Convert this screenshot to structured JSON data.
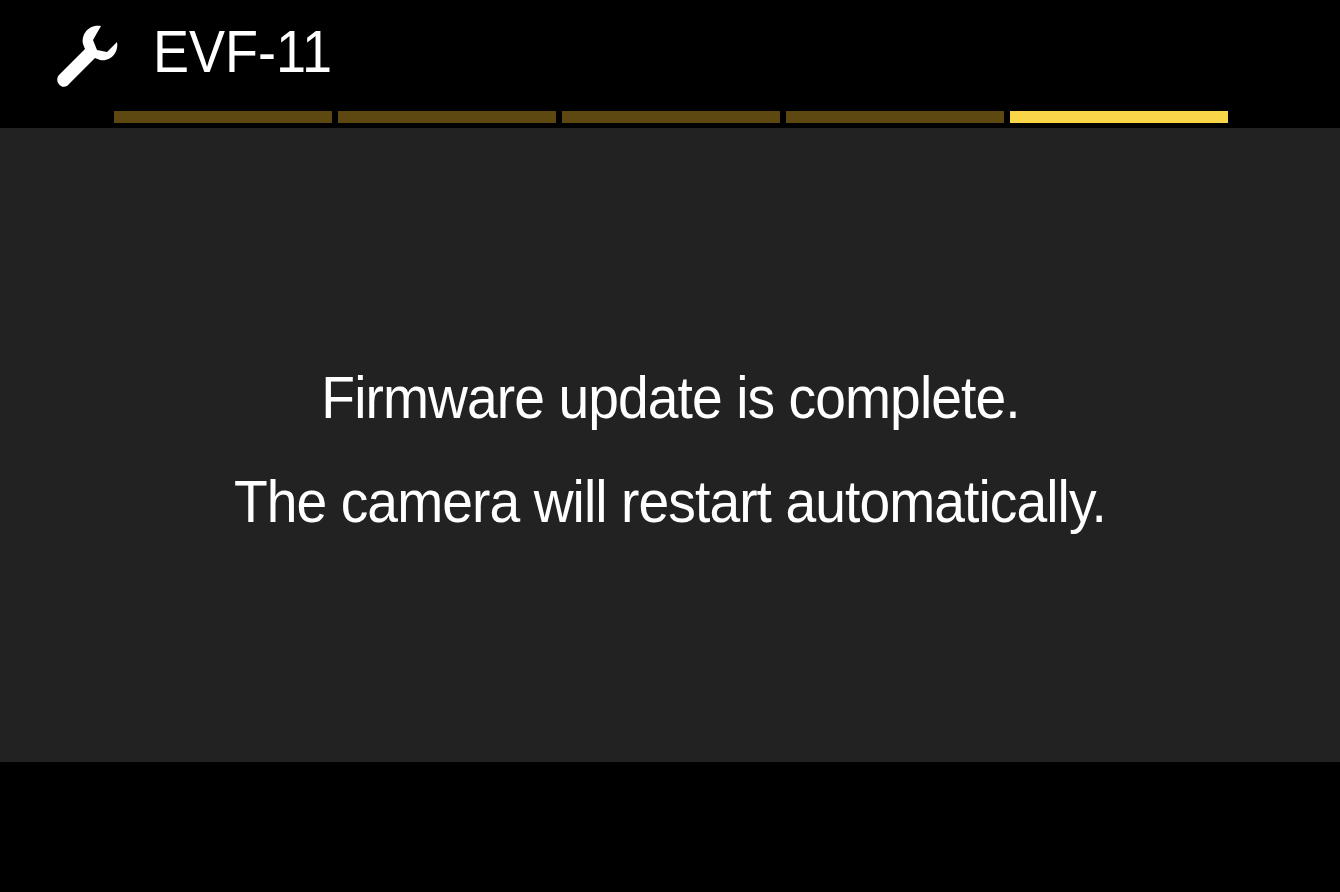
{
  "header": {
    "title": "EVF-11"
  },
  "page_indicator": [
    {
      "selected": false
    },
    {
      "selected": false
    },
    {
      "selected": false
    },
    {
      "selected": false
    },
    {
      "selected": true
    }
  ],
  "message": {
    "lines": [
      "Firmware update is complete.",
      "The camera will restart automatically."
    ]
  }
}
